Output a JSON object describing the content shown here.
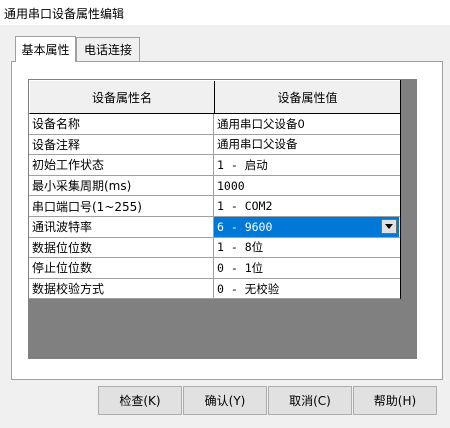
{
  "window": {
    "title": "通用串口设备属性编辑"
  },
  "tabs": [
    {
      "label": "基本属性",
      "active": true
    },
    {
      "label": "电话连接",
      "active": false
    }
  ],
  "grid": {
    "columns": [
      "设备属性名",
      "设备属性值"
    ],
    "rows": [
      {
        "name": "设备名称",
        "value": "通用串口父设备0"
      },
      {
        "name": "设备注释",
        "value": "通用串口父设备"
      },
      {
        "name": "初始工作状态",
        "value": "1 - 启动"
      },
      {
        "name": "最小采集周期(ms)",
        "value": "1000"
      },
      {
        "name": "串口端口号(1~255)",
        "value": "1 - COM2"
      },
      {
        "name": "通讯波特率",
        "value": "6 - 9600",
        "selected": true,
        "dropdown_icon": "chevron-down-icon"
      },
      {
        "name": "数据位位数",
        "value": "1 - 8位"
      },
      {
        "name": "停止位位数",
        "value": "0 - 1位"
      },
      {
        "name": "数据校验方式",
        "value": "0 - 无校验"
      }
    ]
  },
  "buttons": {
    "check": "检查(K)",
    "confirm": "确认(Y)",
    "cancel": "取消(C)",
    "help": "帮助(H)"
  },
  "colors": {
    "selection": "#0078d7",
    "grid_background": "#808080"
  }
}
